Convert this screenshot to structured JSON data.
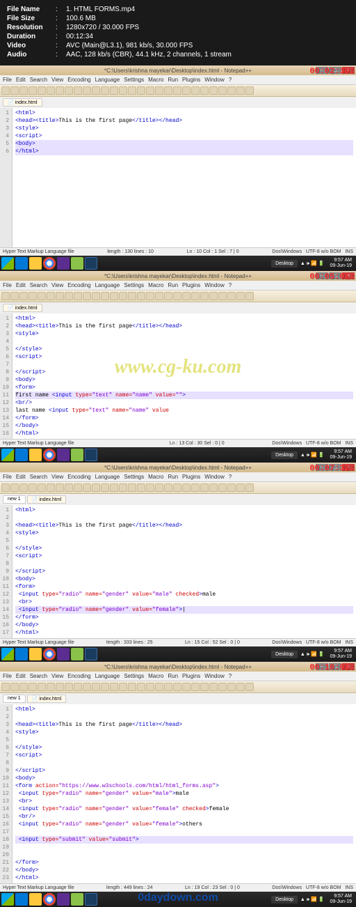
{
  "file_info": {
    "name_label": "File Name",
    "name": "1. HTML FORMS.mp4",
    "size_label": "File Size",
    "size": "100.6 MB",
    "res_label": "Resolution",
    "res": "1280x720 / 30.000 FPS",
    "dur_label": "Duration",
    "dur": "00:12:34",
    "vid_label": "Video",
    "vid": "AVC (Main@L3.1), 981 kb/s, 30.000 FPS",
    "aud_label": "Audio",
    "aud": "AAC, 128 kb/s (CBR), 44.1 kHz, 2 channels, 1 stream"
  },
  "watermark_main": "www.cg-ku.com",
  "watermark_footer": "0daydown.com",
  "menu_items": [
    "File",
    "Edit",
    "Search",
    "View",
    "Encoding",
    "Language",
    "Settings",
    "Macro",
    "Run",
    "Plugins",
    "Window",
    "?"
  ],
  "app_title": "*C:\\Users\\krishna mayekar\\Desktop\\index.html - Notepad++",
  "tab_main": "index.html",
  "tab_new": "new 1",
  "tray": {
    "desktop": "Desktop",
    "time": "9:57 AM",
    "date": "09-Jun-19"
  },
  "status": {
    "filetype": "Hyper Text Markup Language file",
    "enc": "Dos\\Windows",
    "bom": "UTF-8 w/o BOM",
    "mode": "INS"
  },
  "shots": [
    {
      "timestamp": "00:02:30:",
      "lines": [
        {
          "n": 1,
          "html": "<span class='tag'>&lt;html&gt;</span>"
        },
        {
          "n": 2,
          "html": "<span class='tag'>&lt;head&gt;&lt;title&gt;</span>This is the first page<span class='tag'>&lt;/title&gt;&lt;/head&gt;</span>"
        },
        {
          "n": 3,
          "html": "<span class='tag'>&lt;style&gt;</span>"
        },
        {
          "n": 4,
          "html": "<span class='tag'>&lt;script&gt;</span>"
        },
        {
          "n": 5,
          "html": "<span class='tag'>&lt;body&gt;</span>",
          "hl": true
        },
        {
          "n": 6,
          "html": "<span class='tag'>&lt;/html&gt;</span>",
          "hl": true
        }
      ],
      "status_mid": "length : 130   lines : 10",
      "status_pos": "Ln : 10   Col : 1   Sel : 7 | 0"
    },
    {
      "timestamp": "00:05:01:",
      "lines": [
        {
          "n": 1,
          "html": "<span class='tag'>&lt;html&gt;</span>"
        },
        {
          "n": 2,
          "html": "<span class='tag'>&lt;head&gt;&lt;title&gt;</span>This is the first page<span class='tag'>&lt;/title&gt;&lt;/head&gt;</span>"
        },
        {
          "n": 3,
          "html": "<span class='tag'>&lt;style&gt;</span>"
        },
        {
          "n": 4,
          "html": ""
        },
        {
          "n": 5,
          "html": "<span class='tag'>&lt;/style&gt;</span>"
        },
        {
          "n": 6,
          "html": "<span class='tag'>&lt;script&gt;</span>"
        },
        {
          "n": 7,
          "html": ""
        },
        {
          "n": 8,
          "html": "<span class='tag'>&lt;/script&gt;</span>"
        },
        {
          "n": 9,
          "html": "<span class='tag'>&lt;body&gt;</span>"
        },
        {
          "n": 10,
          "html": "<span class='tag'>&lt;form&gt;</span>"
        },
        {
          "n": 11,
          "hl": true,
          "html": "first name <span class='tag'>&lt;input</span> <span class='attr'>type=</span><span class='val'>\"text\"</span> <span class='attr'>name=</span><span class='val'>\"name\"</span> <span class='attr'>value=</span><span class='val'>\"\"</span><span class='tag'>&gt;</span>"
        },
        {
          "n": 12,
          "html": "<span class='tag'>&lt;br/&gt;</span>"
        },
        {
          "n": 13,
          "html": "last name <span class='tag'>&lt;input</span> <span class='attr'>type=</span><span class='val'>\"text\"</span> <span class='attr'>name=</span><span class='val'>\"name\"</span> <span class='attr'>value</span>"
        },
        {
          "n": 14,
          "html": "<span class='tag'>&lt;/form&gt;</span>"
        },
        {
          "n": 15,
          "html": "<span class='tag'>&lt;/body&gt;</span>"
        },
        {
          "n": 16,
          "html": "<span class='tag'>&lt;/html&gt;</span>"
        }
      ],
      "status_mid": "",
      "status_pos": "Ln : 13   Col : 30   Sel : 0 | 0"
    },
    {
      "timestamp": "00:07:32:",
      "lines": [
        {
          "n": 1,
          "html": "<span class='tag'>&lt;html&gt;</span>"
        },
        {
          "n": 2,
          "html": ""
        },
        {
          "n": 3,
          "html": "<span class='tag'>&lt;head&gt;&lt;title&gt;</span>This is the first page<span class='tag'>&lt;/title&gt;&lt;/head&gt;</span>"
        },
        {
          "n": 4,
          "html": "<span class='tag'>&lt;style&gt;</span>"
        },
        {
          "n": 5,
          "html": ""
        },
        {
          "n": 6,
          "html": "<span class='tag'>&lt;/style&gt;</span>"
        },
        {
          "n": 7,
          "html": "<span class='tag'>&lt;script&gt;</span>"
        },
        {
          "n": 8,
          "html": ""
        },
        {
          "n": 9,
          "html": "<span class='tag'>&lt;/script&gt;</span>"
        },
        {
          "n": 10,
          "html": "<span class='tag'>&lt;body&gt;</span>"
        },
        {
          "n": 11,
          "html": "<span class='tag'>&lt;form&gt;</span>"
        },
        {
          "n": 12,
          "html": "&nbsp;<span class='tag'>&lt;input</span> <span class='attr'>type=</span><span class='val'>\"radio\"</span> <span class='attr'>name=</span><span class='val'>\"gender\"</span> <span class='attr'>value=</span><span class='val'>\"male\"</span> <span class='attr'>checked</span><span class='tag'>&gt;</span>male"
        },
        {
          "n": 13,
          "html": "&nbsp;<span class='tag'>&lt;br&gt;</span>"
        },
        {
          "n": 14,
          "hl": true,
          "html": "&nbsp;<span class='tag'>&lt;input</span> <span class='attr'>type=</span><span class='val'>\"radio\"</span> <span class='attr'>name=</span><span class='val'>\"gender\"</span> <span class='attr'>value=</span><span class='val'>\"female\"</span><span class='tag'>&gt;</span>|"
        },
        {
          "n": 15,
          "html": "<span class='tag'>&lt;/form&gt;</span>"
        },
        {
          "n": 16,
          "html": "<span class='tag'>&lt;/body&gt;</span>"
        },
        {
          "n": 17,
          "html": "<span class='tag'>&lt;/html&gt;</span>"
        }
      ],
      "status_mid": "length : 333   lines : 25",
      "status_pos": "Ln : 15   Col : 52   Sel : 0 | 0"
    },
    {
      "timestamp": "00:10:03:",
      "lines": [
        {
          "n": 1,
          "html": "<span class='tag'>&lt;html&gt;</span>"
        },
        {
          "n": 2,
          "html": ""
        },
        {
          "n": 3,
          "html": "<span class='tag'>&lt;head&gt;&lt;title&gt;</span>This is the first page<span class='tag'>&lt;/title&gt;&lt;/head&gt;</span>"
        },
        {
          "n": 4,
          "html": "<span class='tag'>&lt;style&gt;</span>"
        },
        {
          "n": 5,
          "html": ""
        },
        {
          "n": 6,
          "html": "<span class='tag'>&lt;/style&gt;</span>"
        },
        {
          "n": 7,
          "html": "<span class='tag'>&lt;script&gt;</span>"
        },
        {
          "n": 8,
          "html": ""
        },
        {
          "n": 9,
          "html": "<span class='tag'>&lt;/script&gt;</span>"
        },
        {
          "n": 10,
          "html": "<span class='tag'>&lt;body&gt;</span>"
        },
        {
          "n": 11,
          "html": "<span class='tag'>&lt;form</span> <span class='attr'>action=</span><span class='val'>\"https://www.w3schools.com/html/html_forms.asp\"</span><span class='tag'>&gt;</span>"
        },
        {
          "n": 12,
          "html": "&nbsp;<span class='tag'>&lt;input</span> <span class='attr'>type=</span><span class='val'>\"radio\"</span> <span class='attr'>name=</span><span class='val'>\"gender\"</span> <span class='attr'>value=</span><span class='val'>\"male\"</span><span class='tag'>&gt;</span>male"
        },
        {
          "n": 13,
          "html": "&nbsp;<span class='tag'>&lt;br&gt;</span>"
        },
        {
          "n": 14,
          "html": "&nbsp;<span class='tag'>&lt;input</span> <span class='attr'>type=</span><span class='val'>\"radio\"</span> <span class='attr'>name=</span><span class='val'>\"gender\"</span> <span class='attr'>value=</span><span class='val'>\"female\"</span> <span class='attr'>checked</span><span class='tag'>&gt;</span>female"
        },
        {
          "n": 15,
          "html": "&nbsp;<span class='tag'>&lt;br/&gt;</span>"
        },
        {
          "n": 16,
          "html": "&nbsp;<span class='tag'>&lt;input</span> <span class='attr'>type=</span><span class='val'>\"radio\"</span> <span class='attr'>name=</span><span class='val'>\"gender\"</span> <span class='attr'>value=</span><span class='val'>\"female\"</span><span class='tag'>&gt;</span>others"
        },
        {
          "n": 17,
          "html": ""
        },
        {
          "n": 18,
          "hl": true,
          "html": "&nbsp;<span class='tag'>&lt;input</span> <span class='attr'>type=</span><span class='val'>\"submit\"</span> <span class='attr'>value=</span><span class='val'>\"submit\"</span><span class='tag'>&gt;</span>"
        },
        {
          "n": 19,
          "html": ""
        },
        {
          "n": 20,
          "html": ""
        },
        {
          "n": 21,
          "html": "<span class='tag'>&lt;/form&gt;</span>"
        },
        {
          "n": 22,
          "html": "<span class='tag'>&lt;/body&gt;</span>"
        },
        {
          "n": 23,
          "html": "<span class='tag'>&lt;/html&gt;</span>"
        }
      ],
      "status_mid": "length : 449   lines : 24",
      "status_pos": "Ln : 19   Col : 23   Sel : 0 | 0"
    }
  ]
}
